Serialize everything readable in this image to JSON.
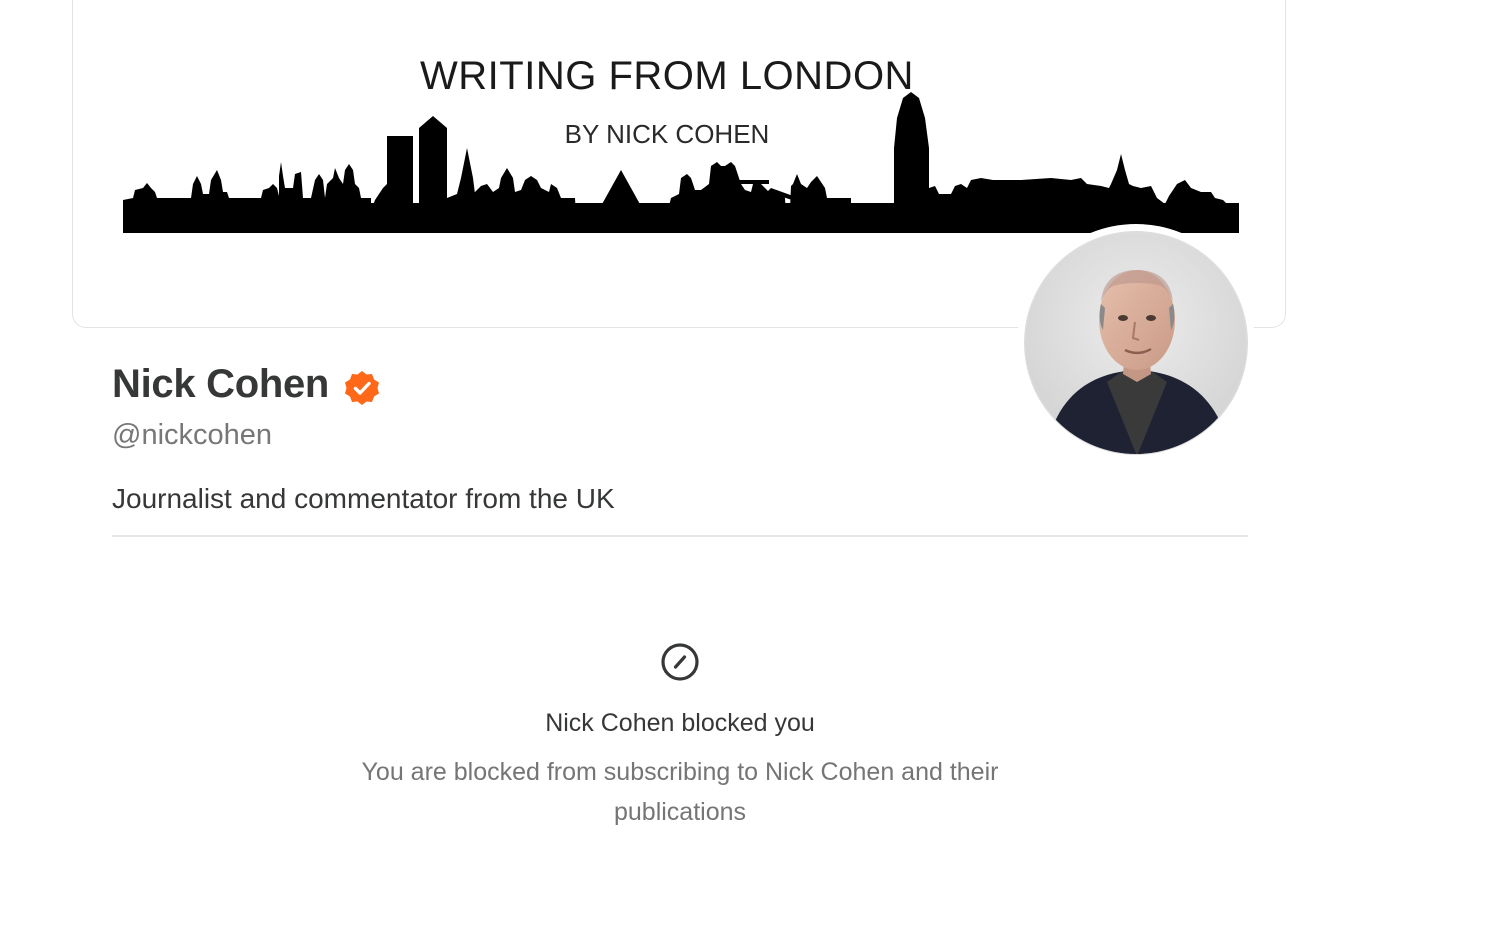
{
  "banner": {
    "title": "WRITING FROM LONDON",
    "subtitle": "BY NICK COHEN"
  },
  "profile": {
    "name": "Nick Cohen",
    "handle": "@nickcohen",
    "bio": "Journalist and commentator from the UK",
    "verified_color": "#FF6719"
  },
  "blocked": {
    "icon": "blocked-icon",
    "title": "Nick Cohen blocked you",
    "description": "You are blocked from subscribing to Nick Cohen and their publications"
  }
}
